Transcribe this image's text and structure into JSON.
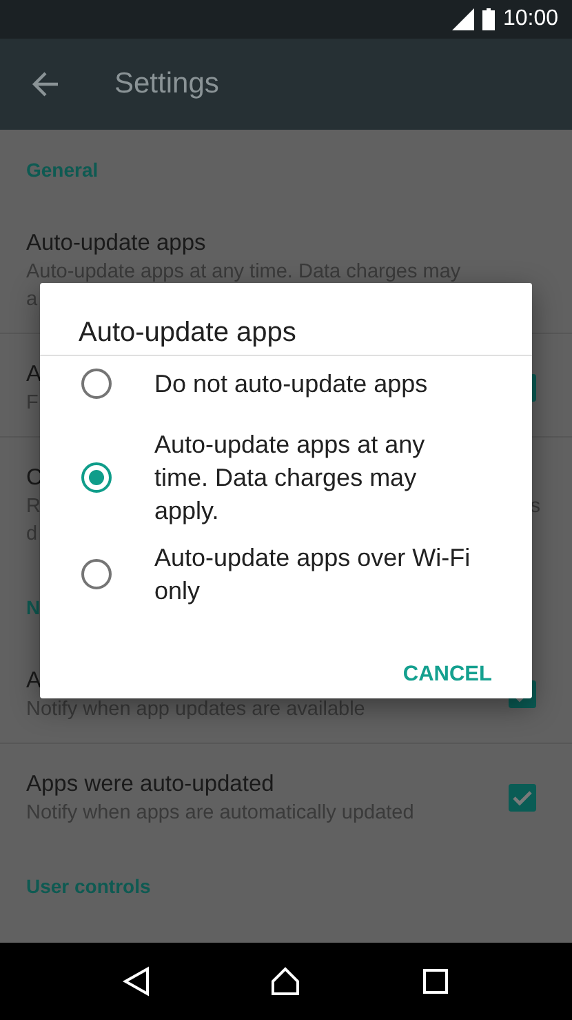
{
  "status_bar": {
    "time": "10:00"
  },
  "app_bar": {
    "title": "Settings"
  },
  "sections": [
    {
      "header": "General",
      "rows": [
        {
          "title": "Auto-update apps",
          "subtitle": "Auto-update apps at any time. Data charges may",
          "subtitle_2": "a"
        },
        {
          "title": "A",
          "subtitle": "F",
          "checkbox": {
            "checked": true
          }
        },
        {
          "title": "C",
          "subtitle": "R",
          "subtitle_right": "s",
          "subtitle_2": "d"
        }
      ]
    },
    {
      "header": "N",
      "rows": [
        {
          "title": "A",
          "subtitle": "Notify when app updates are available",
          "checkbox": {
            "checked": true
          }
        },
        {
          "title": "Apps were auto-updated",
          "subtitle": "Notify when apps are automatically updated",
          "checkbox": {
            "checked": true
          }
        }
      ]
    },
    {
      "header": "User controls"
    }
  ],
  "dialog": {
    "title": "Auto-update apps",
    "options": [
      {
        "label": "Do not auto-update apps",
        "selected": false
      },
      {
        "label": "Auto-update apps at any time. Data charges may apply.",
        "selected": true
      },
      {
        "label": "Auto-update apps over Wi-Fi only",
        "selected": false
      }
    ],
    "button": "CANCEL"
  }
}
